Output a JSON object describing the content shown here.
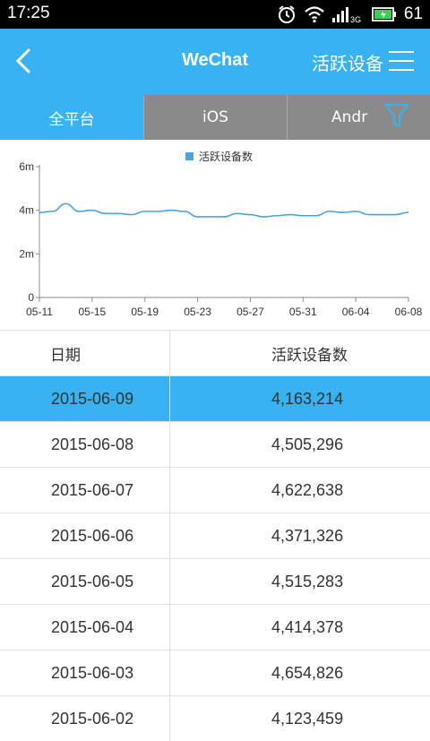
{
  "status": {
    "time": "17:25",
    "network": "3G",
    "battery": "61"
  },
  "appbar": {
    "title": "WeChat",
    "subtitle": "活跃设备"
  },
  "tabs": [
    {
      "label": "全平台",
      "active": true
    },
    {
      "label": "iOS",
      "active": false
    },
    {
      "label": "Andr",
      "active": false
    }
  ],
  "chart_data": {
    "type": "line",
    "legend": "活跃设备数",
    "legend_position": "top-center",
    "y_ticks": [
      "0",
      "2m",
      "4m",
      "6m"
    ],
    "ylim": [
      0,
      6000000
    ],
    "x_ticks": [
      "05-11",
      "05-15",
      "05-19",
      "05-23",
      "05-27",
      "05-31",
      "06-04",
      "06-08"
    ],
    "series": [
      {
        "name": "活跃设备数",
        "color": "#4aa3e0",
        "values": [
          3900000,
          3950000,
          4300000,
          3950000,
          4000000,
          3850000,
          3850000,
          3800000,
          3950000,
          3950000,
          4000000,
          3950000,
          3700000,
          3700000,
          3700000,
          3850000,
          3800000,
          3700000,
          3750000,
          3800000,
          3750000,
          3750000,
          3950000,
          3900000,
          3950000,
          3800000,
          3800000,
          3800000,
          3900000
        ]
      }
    ]
  },
  "table": {
    "headers": [
      "日期",
      "活跃设备数"
    ],
    "rows": [
      {
        "date": "2015-06-09",
        "value": "4,163,214",
        "selected": true
      },
      {
        "date": "2015-06-08",
        "value": "4,505,296"
      },
      {
        "date": "2015-06-07",
        "value": "4,622,638"
      },
      {
        "date": "2015-06-06",
        "value": "4,371,326"
      },
      {
        "date": "2015-06-05",
        "value": "4,515,283"
      },
      {
        "date": "2015-06-04",
        "value": "4,414,378"
      },
      {
        "date": "2015-06-03",
        "value": "4,654,826"
      },
      {
        "date": "2015-06-02",
        "value": "4,123,459"
      }
    ]
  }
}
